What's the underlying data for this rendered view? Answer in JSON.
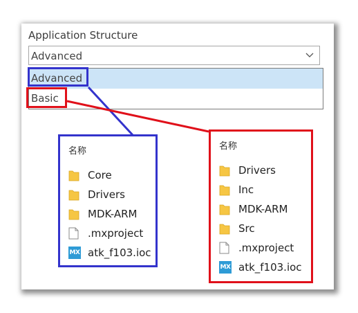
{
  "app_structure": {
    "label": "Application Structure",
    "selected_value": "Advanced",
    "options": [
      "Advanced",
      "Basic"
    ]
  },
  "advanced_panel": {
    "column_header": "名称",
    "items": [
      {
        "name": "Core",
        "icon": "folder-icon"
      },
      {
        "name": "Drivers",
        "icon": "folder-icon"
      },
      {
        "name": "MDK-ARM",
        "icon": "folder-icon"
      },
      {
        "name": ".mxproject",
        "icon": "file-icon"
      },
      {
        "name": "atk_f103.ioc",
        "icon": "mx-file-icon",
        "badge": "MX"
      }
    ]
  },
  "basic_panel": {
    "column_header": "名称",
    "items": [
      {
        "name": "Drivers",
        "icon": "folder-icon"
      },
      {
        "name": "Inc",
        "icon": "folder-icon"
      },
      {
        "name": "MDK-ARM",
        "icon": "folder-icon"
      },
      {
        "name": "Src",
        "icon": "folder-icon"
      },
      {
        "name": ".mxproject",
        "icon": "file-icon"
      },
      {
        "name": "atk_f103.ioc",
        "icon": "mx-file-icon",
        "badge": "MX"
      }
    ]
  },
  "colors": {
    "annotation_blue": "#3333cc",
    "annotation_red": "#e0101a",
    "selected_option_bg": "#cce4f7",
    "folder_yellow": "#f6c644",
    "mx_blue": "#2e9bd6"
  }
}
